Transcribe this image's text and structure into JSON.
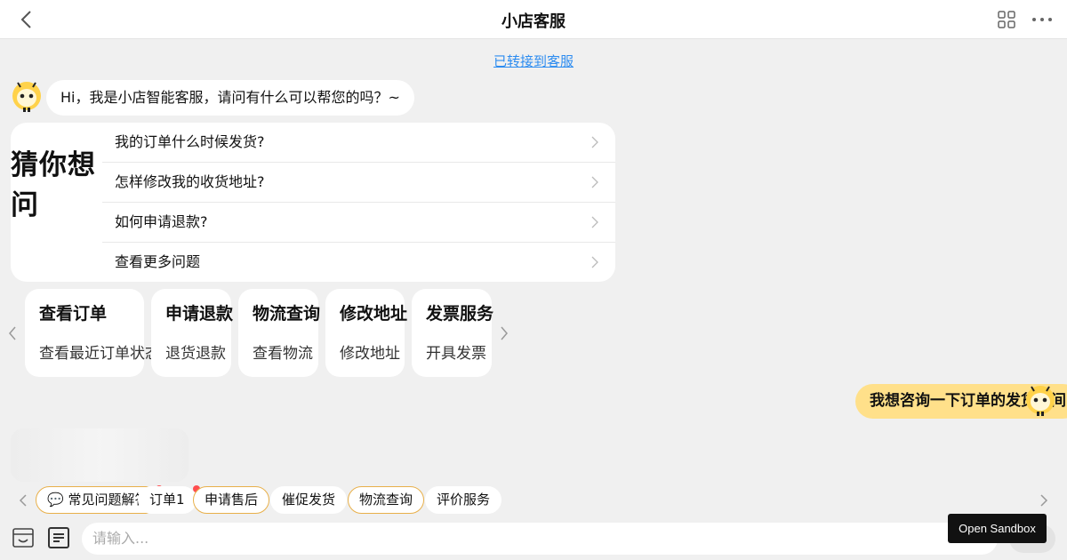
{
  "header": {
    "title": "小店客服",
    "back_icon": "chevron-left-icon",
    "grid_icon": "grid-icon",
    "more_icon": "more-dots-icon"
  },
  "system_link": "已转接到客服",
  "greeting": "Hi，我是小店智能客服，请问有什么可以帮您的吗？~",
  "faq": {
    "title": "猜你想问",
    "items": [
      {
        "label": "我的订单什么时候发货?"
      },
      {
        "label": "怎样修改我的收货地址?"
      },
      {
        "label": "如何申请退款?"
      },
      {
        "label": "查看更多问题"
      }
    ]
  },
  "cards": [
    {
      "title": "查看订单",
      "subtitle": "查看最近订单状态"
    },
    {
      "title": "申请退款",
      "subtitle": "退货退款"
    },
    {
      "title": "物流查询",
      "subtitle": "查看物流"
    },
    {
      "title": "修改地址",
      "subtitle": "修改地址"
    },
    {
      "title": "发票服务",
      "subtitle": "开具发票"
    }
  ],
  "user_message": "我想咨询一下订单的发货时间",
  "quick_chips": [
    {
      "label": "💬 常见问题解答",
      "highlight": true,
      "dot": true
    },
    {
      "label": "订单1",
      "highlight": false,
      "dot": true
    },
    {
      "label": "申请售后",
      "highlight": true,
      "dot": false
    },
    {
      "label": "催促发货",
      "highlight": false,
      "dot": false
    },
    {
      "label": "物流查询",
      "highlight": true,
      "dot": false
    },
    {
      "label": "评价服务",
      "highlight": false,
      "dot": false
    }
  ],
  "input": {
    "placeholder": "请输入..."
  },
  "sandbox_button": "Open Sandbox",
  "colors": {
    "accent_link": "#2d8cf0",
    "user_bubble": "#ffe08a",
    "chip_highlight": "#e8b04a",
    "badge": "#ff4d4f"
  }
}
